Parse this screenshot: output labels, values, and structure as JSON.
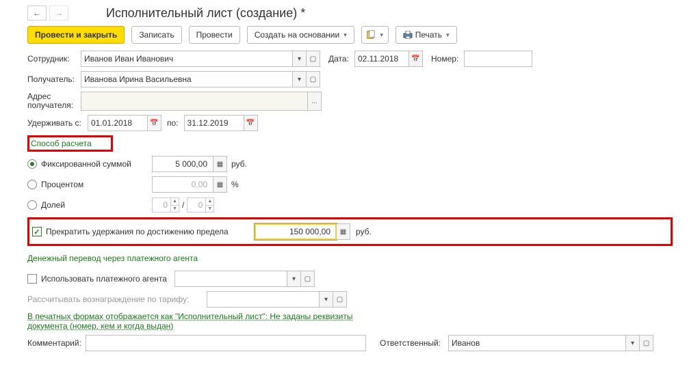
{
  "title": "Исполнительный лист (создание) *",
  "toolbar": {
    "post_close": "Провести и закрыть",
    "save": "Записать",
    "post": "Провести",
    "create_based": "Создать на основании",
    "print": "Печать"
  },
  "labels": {
    "employee": "Сотрудник:",
    "date": "Дата:",
    "number": "Номер:",
    "recipient": "Получатель:",
    "recipient_addr_l1": "Адрес",
    "recipient_addr_l2": "получателя:",
    "withhold_from": "Удерживать с:",
    "to": "по:",
    "calc_method": "Способ расчета",
    "fixed_sum": "Фиксированной суммой",
    "percent": "Процентом",
    "fraction": "Долей",
    "rub": "руб.",
    "pct": "%",
    "slash": "/",
    "stop_limit": "Прекратить удержания по достижению предела",
    "transfer_agent": "Денежный перевод через платежного агента",
    "use_agent": "Использовать платежного агента",
    "reward_tariff": "Рассчитывать вознаграждение по тарифу:",
    "print_note": "В печатных формах отображается как \"Исполнительный лист\": Не заданы реквизиты документа (номер, кем и когда выдан)",
    "comment": "Комментарий:",
    "responsible": "Ответственный:",
    "ellipsis": "..."
  },
  "values": {
    "employee": "Иванов Иван Иванович",
    "date": "02.11.2018",
    "number": "",
    "recipient": "Иванова Ирина Васильевна",
    "recipient_addr": "",
    "withhold_from": "01.01.2018",
    "withhold_to": "31.12.2019",
    "fixed_sum": "5 000,00",
    "percent": "0,00",
    "fraction_num": "0",
    "fraction_den": "0",
    "limit": "150 000,00",
    "agent": "",
    "tariff": "",
    "comment": "",
    "responsible": "Иванов"
  }
}
